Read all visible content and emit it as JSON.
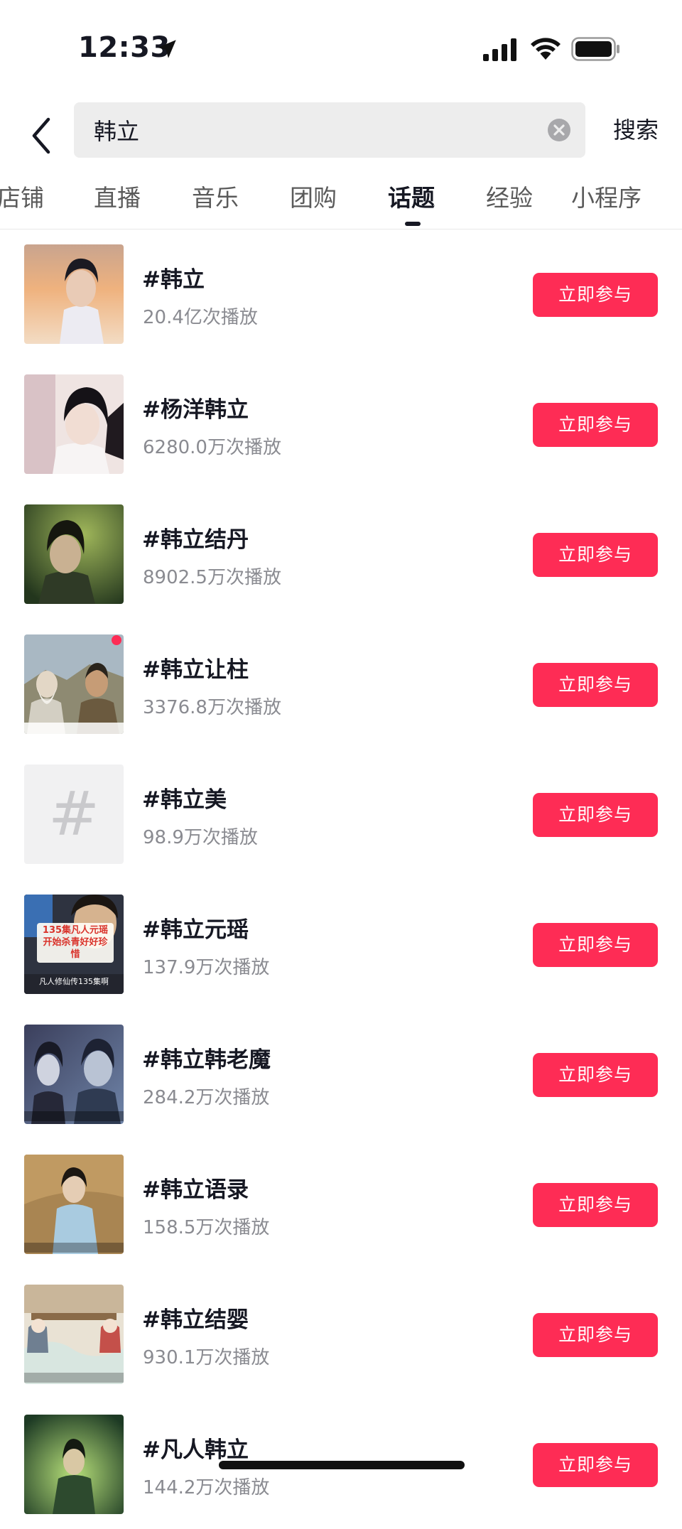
{
  "status_bar": {
    "time": "12:33",
    "icons": [
      "location-arrow-icon",
      "signal-icon",
      "wifi-icon",
      "battery-icon"
    ]
  },
  "search": {
    "query": "韩立",
    "button_label": "搜索",
    "icons": [
      "back-icon",
      "clear-icon"
    ]
  },
  "tabs": [
    {
      "label": "店铺"
    },
    {
      "label": "直播"
    },
    {
      "label": "音乐"
    },
    {
      "label": "团购"
    },
    {
      "label": "话题"
    },
    {
      "label": "经验"
    },
    {
      "label": "小程序"
    }
  ],
  "active_tab": "话题",
  "topics": [
    {
      "title": "#韩立",
      "plays": "20.4亿次播放",
      "button": "立即参与"
    },
    {
      "title": "#杨洋韩立",
      "plays": "6280.0万次播放",
      "button": "立即参与"
    },
    {
      "title": "#韩立结丹",
      "plays": "8902.5万次播放",
      "button": "立即参与"
    },
    {
      "title": "#韩立让柱",
      "plays": "3376.8万次播放",
      "button": "立即参与"
    },
    {
      "title": "#韩立美",
      "plays": "98.9万次播放",
      "button": "立即参与",
      "thumb_placeholder": "#"
    },
    {
      "title": "#韩立元瑶",
      "plays": "137.9万次播放",
      "button": "立即参与",
      "thumb_caption": "135集凡人元瑶开始杀青好好珍惜",
      "thumb_subcaption": "凡人修仙传135集啊"
    },
    {
      "title": "#韩立韩老魔",
      "plays": "284.2万次播放",
      "button": "立即参与"
    },
    {
      "title": "#韩立语录",
      "plays": "158.5万次播放",
      "button": "立即参与"
    },
    {
      "title": "#韩立结婴",
      "plays": "930.1万次播放",
      "button": "立即参与"
    },
    {
      "title": "#凡人韩立",
      "plays": "144.2万次播放",
      "button": "立即参与"
    }
  ],
  "colors": {
    "accent": "#fe2c55",
    "text_primary": "#161823",
    "text_secondary": "#8a8b91",
    "search_bg": "#ededed"
  }
}
